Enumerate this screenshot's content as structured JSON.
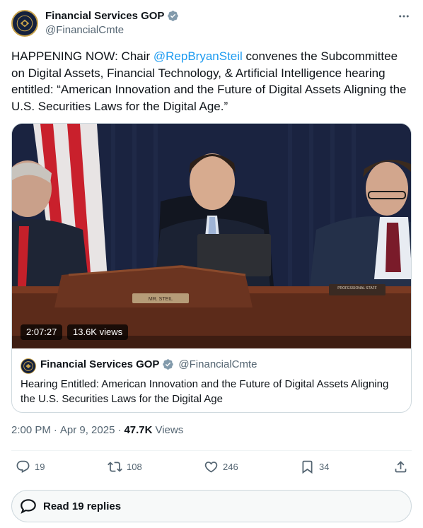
{
  "author": {
    "name": "Financial Services GOP",
    "handle": "@FinancialCmte"
  },
  "tweet": {
    "text_before": "HAPPENING NOW: Chair ",
    "mention": "@RepBryanSteil",
    "text_after": " convenes the Subcommittee on Digital Assets, Financial Technology, & Artificial Intelligence hearing entitled: “American Innovation and the Future of Digital Assets Aligning the U.S. Securities Laws for the Digital Age.”"
  },
  "video": {
    "duration": "2:07:27",
    "views": "13.6K views",
    "nameplate_center": "MR. STEIL",
    "nameplate_right": "PROFESSIONAL STAFF"
  },
  "quote": {
    "name": "Financial Services GOP",
    "handle": "@FinancialCmte",
    "text": "Hearing Entitled: American Innovation and the Future of Digital Assets Aligning the U.S. Securities Laws for the Digital Age"
  },
  "meta": {
    "time": "2:00 PM",
    "sep1": "·",
    "date": "Apr 9, 2025",
    "sep2": "·",
    "views_count": "47.7K",
    "views_label": "Views"
  },
  "actions": {
    "replies": "19",
    "reposts": "108",
    "likes": "246",
    "bookmarks": "34"
  },
  "read_replies": "Read 19 replies",
  "colors": {
    "accent": "#1d9bf0",
    "muted": "#536471",
    "text": "#0f1419",
    "border": "#cfd9de"
  },
  "icons": [
    "verified-badge-icon",
    "more-icon",
    "reply-icon",
    "repost-icon",
    "like-icon",
    "bookmark-icon",
    "share-icon",
    "speech-bubble-icon"
  ]
}
